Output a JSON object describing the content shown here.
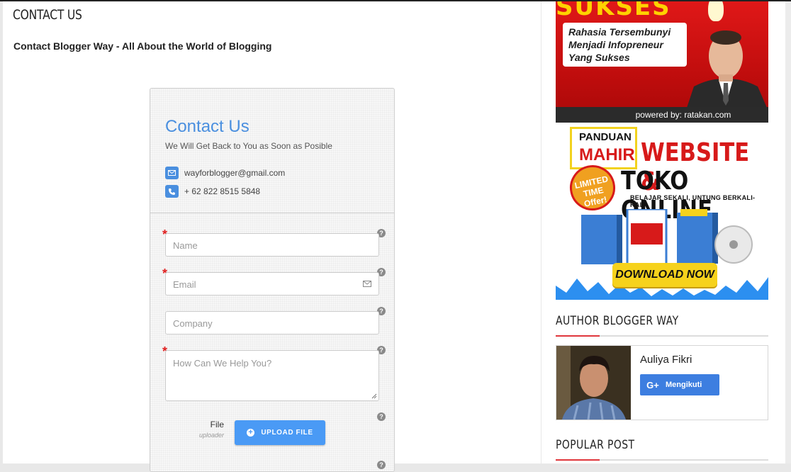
{
  "main": {
    "heading": "CONTACT US",
    "subtitle": "Contact Blogger Way - All About the World of Blogging"
  },
  "form": {
    "title": "Contact Us",
    "tagline": "We Will Get Back to You as Soon as Posible",
    "email": "wayforblogger@gmail.com",
    "phone": "+ 62 822 8515 5848",
    "fields": {
      "name_placeholder": "Name",
      "email_placeholder": "Email",
      "company_placeholder": "Company",
      "message_placeholder": "How Can We Help You?"
    },
    "required_mark": "*",
    "help_mark": "?",
    "file_label": "File",
    "file_sublabel": "uploader",
    "upload_button": "UPLOAD FILE"
  },
  "sidebar": {
    "banner1": {
      "headline": "SUKSES",
      "lines": [
        "Rahasia Tersembunyi",
        "Menjadi Infopreneur",
        "Yang Sukses"
      ],
      "footer": "powered by: ratakan.com"
    },
    "banner2": {
      "panduan": "PANDUAN",
      "mahir": "MAHIR",
      "website": "WEBSITE &",
      "toko": "TOKO ONLINE",
      "tagline": "BELAJAR SEKALI, UNTUNG BERKALI-KALI",
      "badge": "LIMITED TIME Offer!",
      "cta": "DOWNLOAD NOW"
    },
    "author_title": "AUTHOR BLOGGER WAY",
    "author_name": "Auliya Fikri",
    "follow_icon": "G+",
    "follow_label": "Mengikuti",
    "popular_title": "POPULAR POST"
  },
  "colors": {
    "accent_blue": "#4a8fdf",
    "button_blue": "#4a9af5",
    "sidebar_accent": "#e0363c"
  }
}
